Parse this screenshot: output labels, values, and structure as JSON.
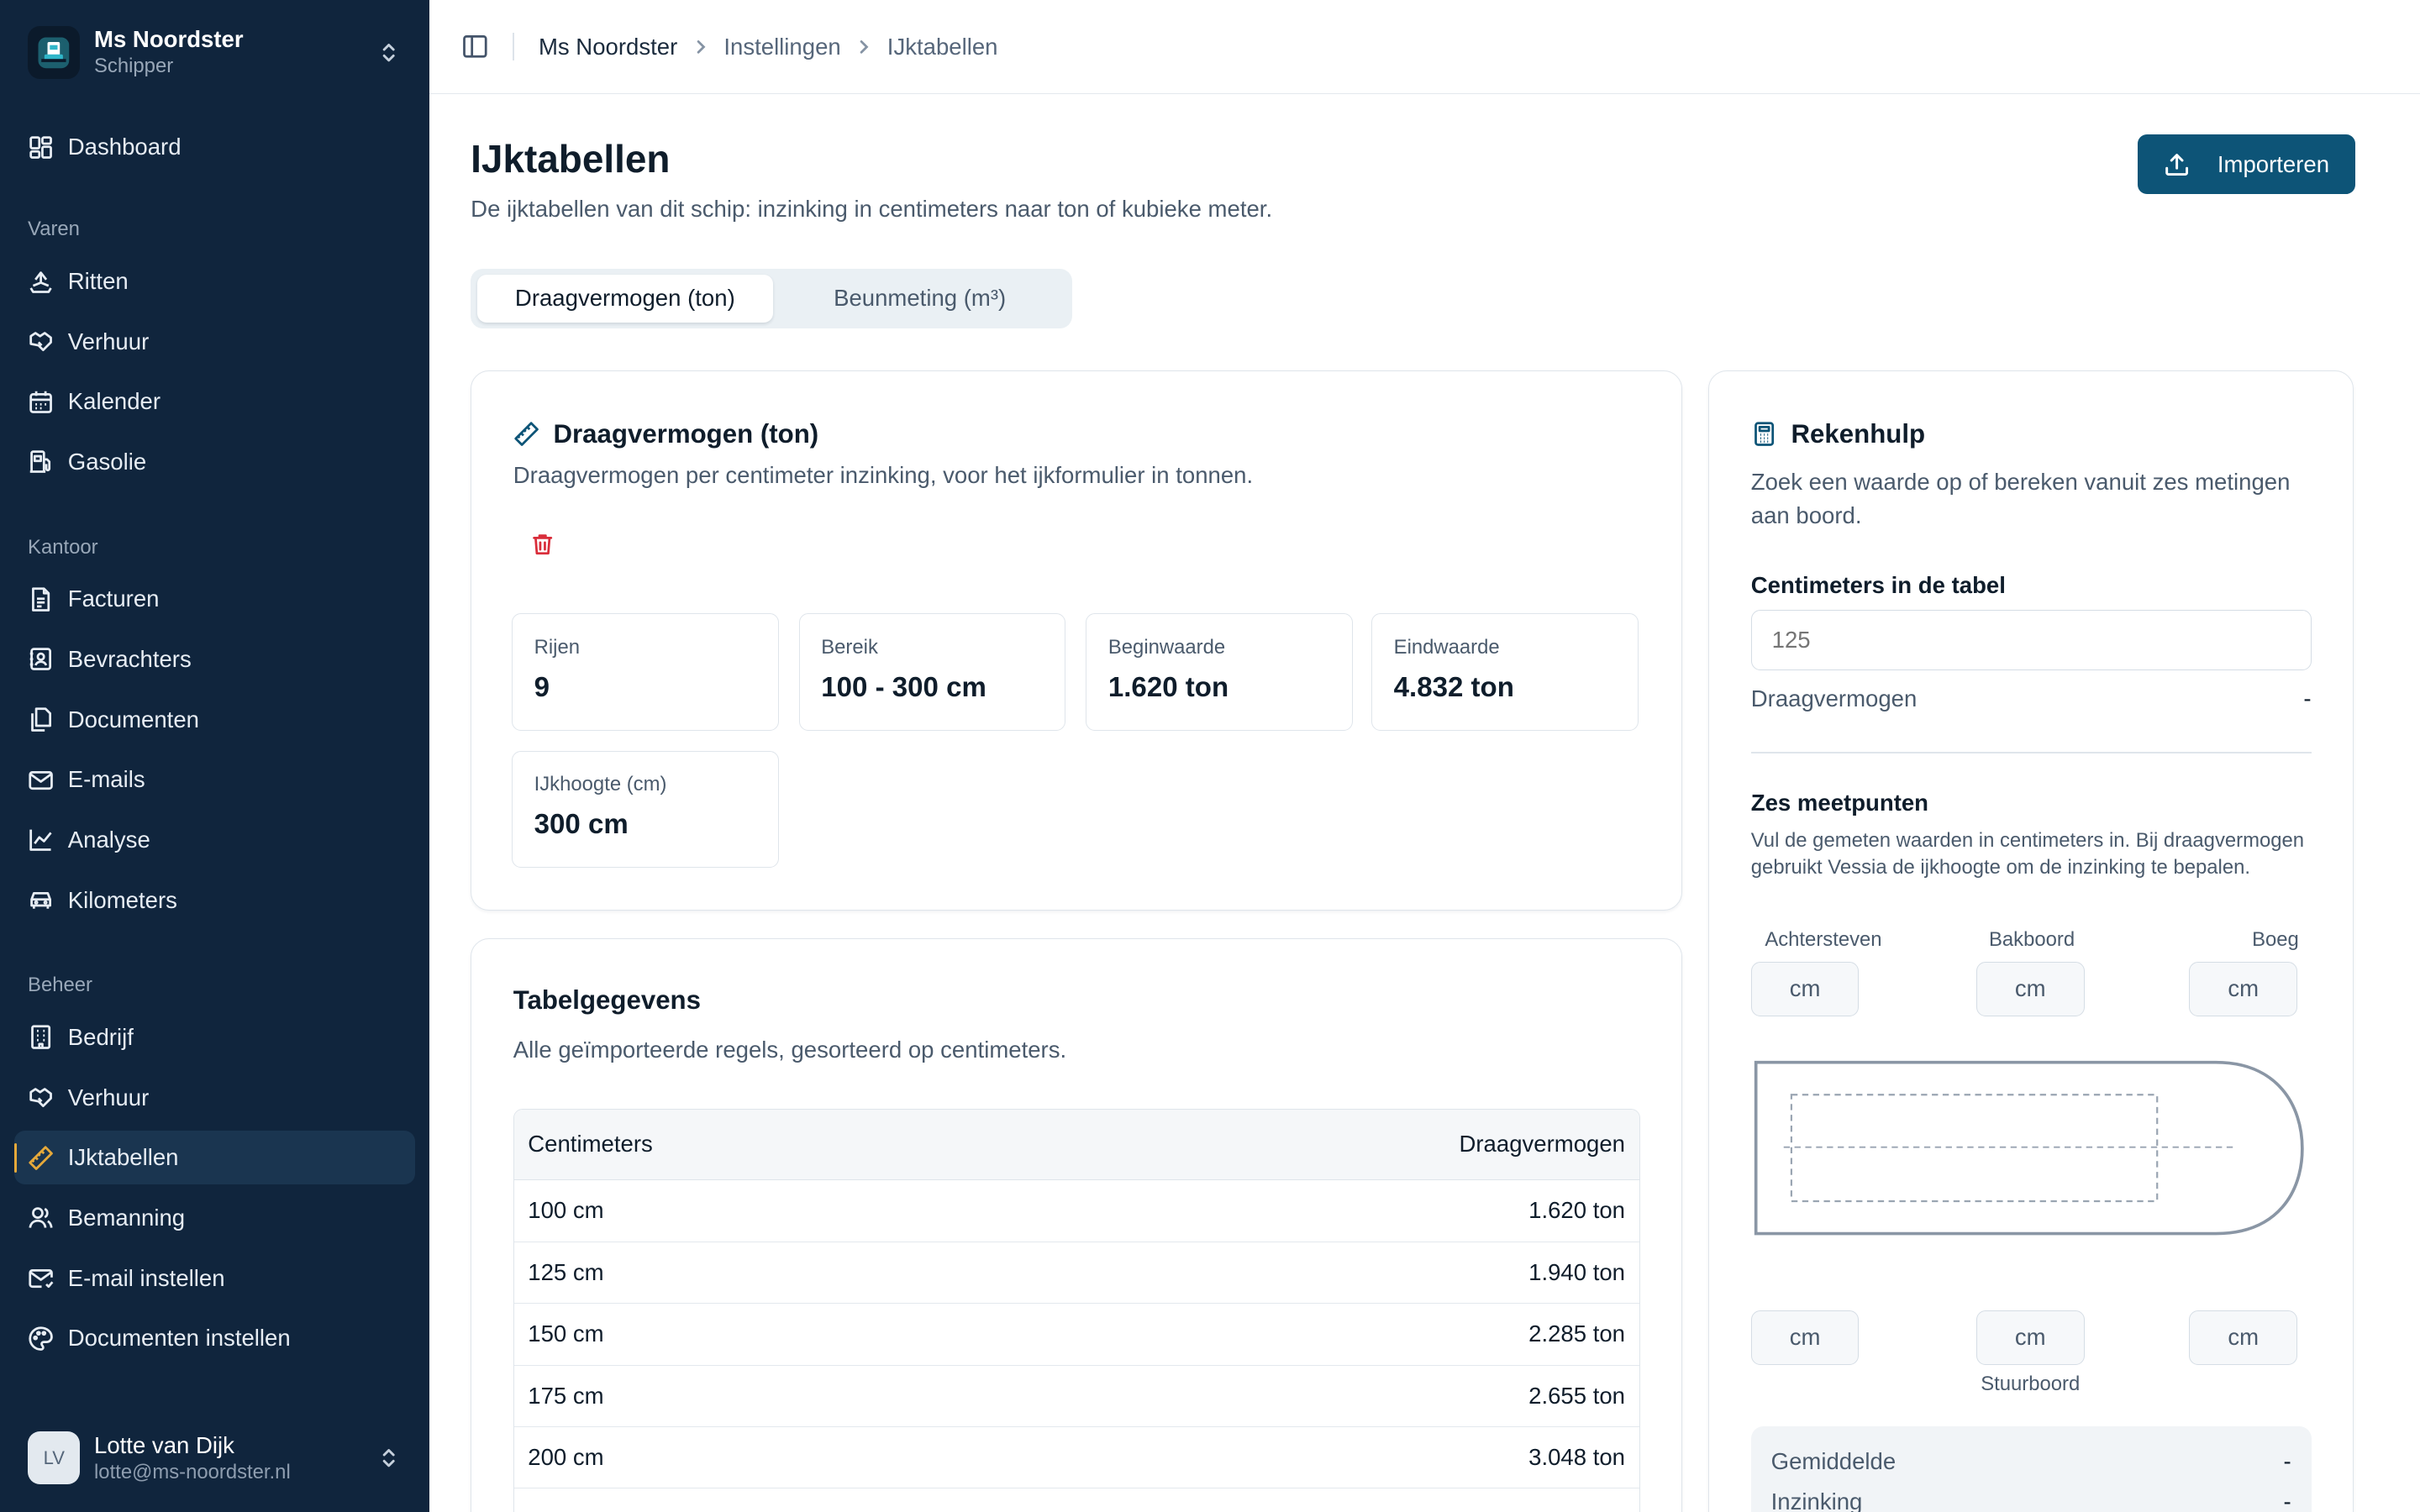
{
  "workspace": {
    "name": "Ms Noordster",
    "role": "Schipper"
  },
  "nav": {
    "top": [
      {
        "label": "Dashboard",
        "icon": "dashboard-icon"
      }
    ],
    "groups": [
      {
        "label": "Varen",
        "items": [
          {
            "label": "Ritten",
            "icon": "ship-icon"
          },
          {
            "label": "Verhuur",
            "icon": "handshake-icon"
          },
          {
            "label": "Kalender",
            "icon": "calendar-icon"
          },
          {
            "label": "Gasolie",
            "icon": "fuel-icon"
          }
        ]
      },
      {
        "label": "Kantoor",
        "items": [
          {
            "label": "Facturen",
            "icon": "invoice-icon"
          },
          {
            "label": "Bevrachters",
            "icon": "contact-icon"
          },
          {
            "label": "Documenten",
            "icon": "documents-icon"
          },
          {
            "label": "E-mails",
            "icon": "mail-icon"
          },
          {
            "label": "Analyse",
            "icon": "chart-icon"
          },
          {
            "label": "Kilometers",
            "icon": "car-icon"
          }
        ]
      },
      {
        "label": "Beheer",
        "items": [
          {
            "label": "Bedrijf",
            "icon": "building-icon"
          },
          {
            "label": "Verhuur",
            "icon": "handshake-icon"
          },
          {
            "label": "IJktabellen",
            "icon": "ruler-icon",
            "active": true
          },
          {
            "label": "Bemanning",
            "icon": "users-icon"
          },
          {
            "label": "E-mail instellen",
            "icon": "mail-settings-icon"
          },
          {
            "label": "Documenten instellen",
            "icon": "palette-icon"
          }
        ]
      }
    ]
  },
  "user": {
    "initials": "LV",
    "name": "Lotte van Dijk",
    "email": "lotte@ms-noordster.nl"
  },
  "breadcrumb": [
    "Ms Noordster",
    "Instellingen",
    "IJktabellen"
  ],
  "page": {
    "title": "IJktabellen",
    "subtitle": "De ijktabellen van dit schip: inzinking in centimeters naar ton of kubieke meter.",
    "import_label": "Importeren"
  },
  "tabs": [
    "Draagvermogen (ton)",
    "Beunmeting (m³)"
  ],
  "overview": {
    "title": "Draagvermogen (ton)",
    "description": "Draagvermogen per centimeter inzinking, voor het ijkformulier in tonnen.",
    "stats": [
      {
        "label": "Rijen",
        "value": "9"
      },
      {
        "label": "Bereik",
        "value": "100 - 300 cm"
      },
      {
        "label": "Beginwaarde",
        "value": "1.620 ton"
      },
      {
        "label": "Eindwaarde",
        "value": "4.832 ton"
      },
      {
        "label": "IJkhoogte (cm)",
        "value": "300 cm"
      }
    ]
  },
  "table": {
    "title": "Tabelgegevens",
    "description": "Alle geïmporteerde regels, gesorteerd op centimeters.",
    "columns": [
      "Centimeters",
      "Draagvermogen"
    ],
    "rows": [
      [
        "100 cm",
        "1.620 ton"
      ],
      [
        "125 cm",
        "1.940 ton"
      ],
      [
        "150 cm",
        "2.285 ton"
      ],
      [
        "175 cm",
        "2.655 ton"
      ],
      [
        "200 cm",
        "3.048 ton"
      ]
    ]
  },
  "calculator": {
    "title": "Rekenhulp",
    "description": "Zoek een waarde op of bereken vanuit zes metingen aan boord.",
    "lookup_label": "Centimeters in de tabel",
    "lookup_placeholder": "125",
    "result_label": "Draagvermogen",
    "result_value": "-",
    "six_title": "Zes meetpunten",
    "six_desc": "Vul de gemeten waarden in centimeters in. Bij draagvermogen gebruikt Vessia de ijkhoogte om de inzinking te bepalen.",
    "labels_top": [
      "Achtersteven",
      "Bakboord",
      "Boeg"
    ],
    "label_bottom": "Stuurboord",
    "placeholder": "cm",
    "summary": [
      {
        "label": "Gemiddelde",
        "value": "-"
      },
      {
        "label": "Inzinking",
        "value": "-"
      }
    ]
  }
}
